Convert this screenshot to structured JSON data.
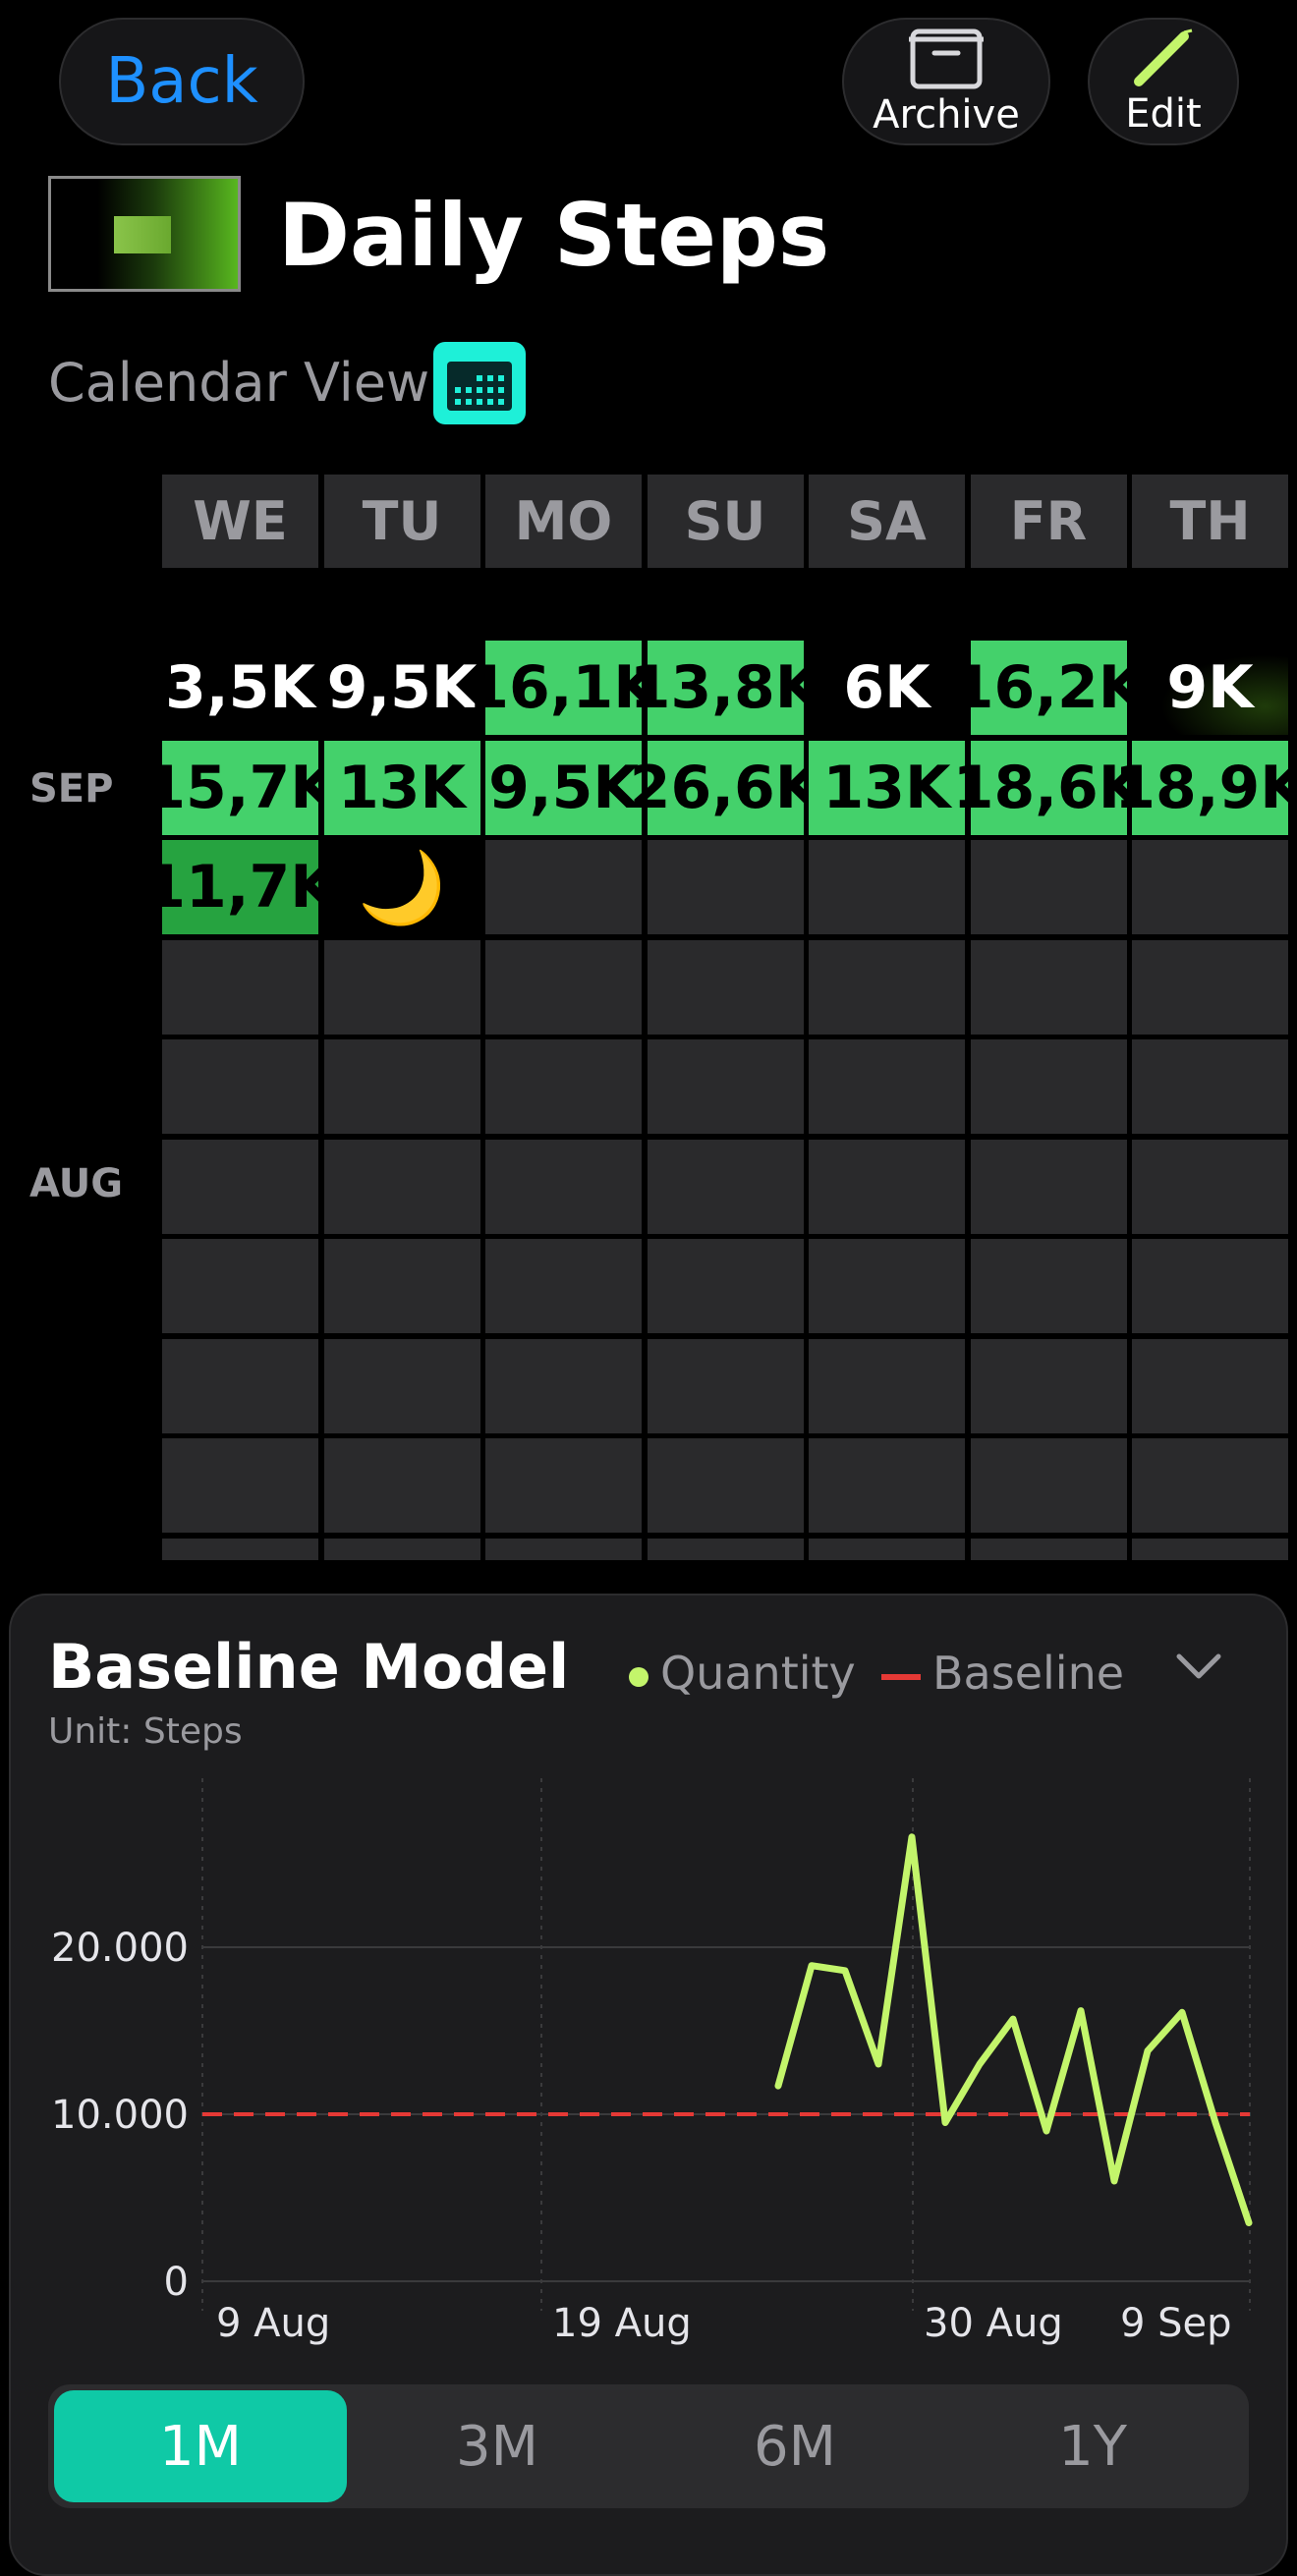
{
  "header": {
    "back_label": "Back",
    "archive_label": "Archive",
    "edit_label": "Edit"
  },
  "title": "Daily Steps",
  "calendar": {
    "view_label": "Calendar View",
    "weekdays": [
      "WE",
      "TU",
      "MO",
      "SU",
      "SA",
      "FR",
      "TH"
    ],
    "months": [
      "SEP",
      "AUG"
    ],
    "rows": [
      [
        {
          "text": "3,5K",
          "style": "black"
        },
        {
          "text": "9,5K",
          "style": "black"
        },
        {
          "text": "16,1K",
          "style": "val"
        },
        {
          "text": "13,8K",
          "style": "val"
        },
        {
          "text": "6K",
          "style": "black"
        },
        {
          "text": "16,2K",
          "style": "val"
        },
        {
          "text": "9K",
          "style": "dim"
        }
      ],
      [
        {
          "text": "15,7K",
          "style": "val"
        },
        {
          "text": "13K",
          "style": "val"
        },
        {
          "text": "9,5K",
          "style": "val"
        },
        {
          "text": "26,6K",
          "style": "val"
        },
        {
          "text": "13K",
          "style": "val"
        },
        {
          "text": "18,6K",
          "style": "val"
        },
        {
          "text": "18,9K",
          "style": "val"
        }
      ],
      [
        {
          "text": "11,7K",
          "style": "dark"
        },
        {
          "text": "🌙",
          "style": "empty"
        },
        {
          "text": "",
          "style": "grey"
        },
        {
          "text": "",
          "style": "grey"
        },
        {
          "text": "",
          "style": "grey"
        },
        {
          "text": "",
          "style": "grey"
        },
        {
          "text": "",
          "style": "grey"
        }
      ]
    ]
  },
  "model": {
    "title": "Baseline Model",
    "unit": "Unit: Steps",
    "legend_quantity": "Quantity",
    "legend_baseline": "Baseline",
    "quantity_color": "#c3f56b",
    "baseline_color": "#e53935"
  },
  "chart_data": {
    "type": "line",
    "x_labels": [
      "9 Aug",
      "19 Aug",
      "30 Aug",
      "9 Sep"
    ],
    "y_ticks": [
      "0",
      "10.000",
      "20.000"
    ],
    "ylim": [
      0,
      27000
    ],
    "series": [
      {
        "name": "Quantity",
        "x": [
          "25 Aug",
          "26 Aug",
          "27 Aug",
          "28 Aug",
          "29 Aug",
          "30 Aug",
          "31 Aug",
          "1 Sep",
          "2 Sep",
          "3 Sep",
          "4 Sep",
          "5 Sep",
          "6 Sep",
          "7 Sep",
          "8 Sep",
          "9 Sep"
        ],
        "values": [
          11700,
          18900,
          18600,
          13000,
          26600,
          9500,
          13000,
          15700,
          9000,
          16200,
          6000,
          13800,
          16100,
          9500,
          3500,
          3500
        ]
      },
      {
        "name": "Baseline",
        "values": [
          10000
        ]
      }
    ]
  },
  "ranges": {
    "options": [
      "1M",
      "3M",
      "6M",
      "1Y"
    ],
    "selected": "1M"
  }
}
